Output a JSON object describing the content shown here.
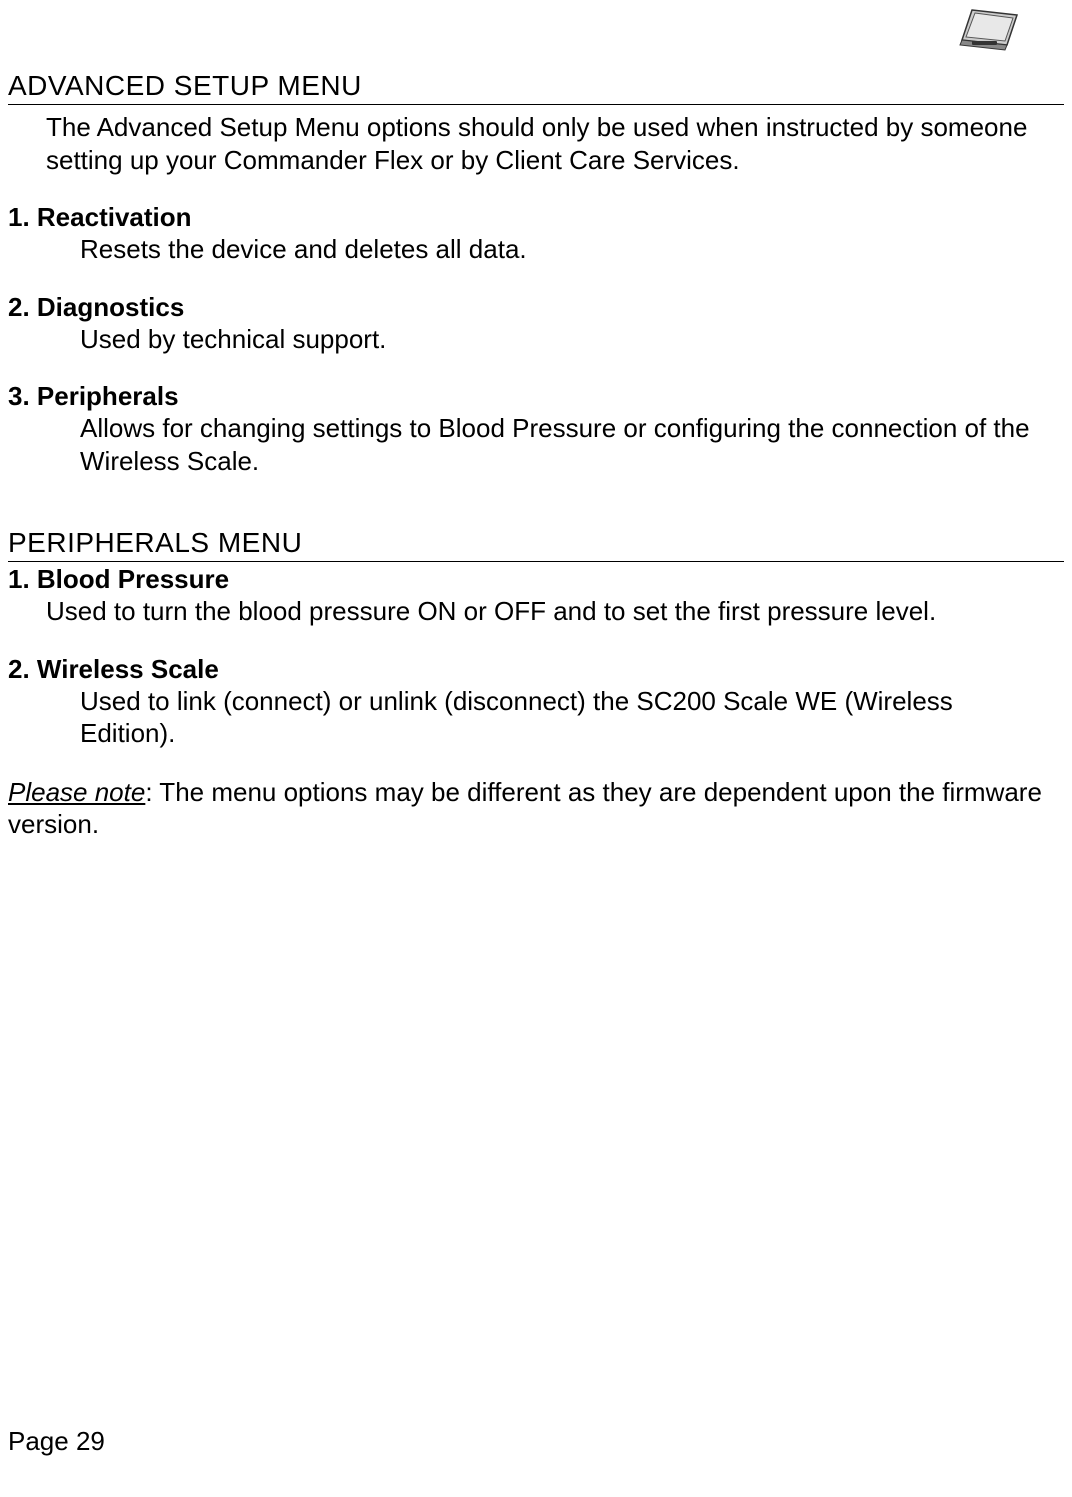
{
  "header": {
    "icon_name": "device-icon"
  },
  "section1": {
    "heading": "ADVANCED SETUP MENU",
    "intro": "The Advanced Setup Menu options should only be used when instructed by someone setting up your Commander Flex or by Client Care Services.",
    "items": [
      {
        "title": "1. Reactivation",
        "desc": "Resets the device and deletes all data."
      },
      {
        "title": "2. Diagnostics",
        "desc": "Used by technical support."
      },
      {
        "title": "3. Peripherals",
        "desc": "Allows for changing settings to Blood Pressure or configuring the connection of the Wireless Scale."
      }
    ]
  },
  "section2": {
    "heading": "PERIPHERALS MENU",
    "items": [
      {
        "title": "1. Blood Pressure",
        "desc": "Used to turn the blood pressure ON or OFF and to set the first pressure level."
      },
      {
        "title": "2. Wireless Scale",
        "desc": "Used to link (connect) or unlink (disconnect) the SC200 Scale WE (Wireless Edition)."
      }
    ],
    "note_label": "Please note",
    "note_text": ":  The menu options may be different as they are dependent upon the firmware version."
  },
  "page_num": "Page 29"
}
